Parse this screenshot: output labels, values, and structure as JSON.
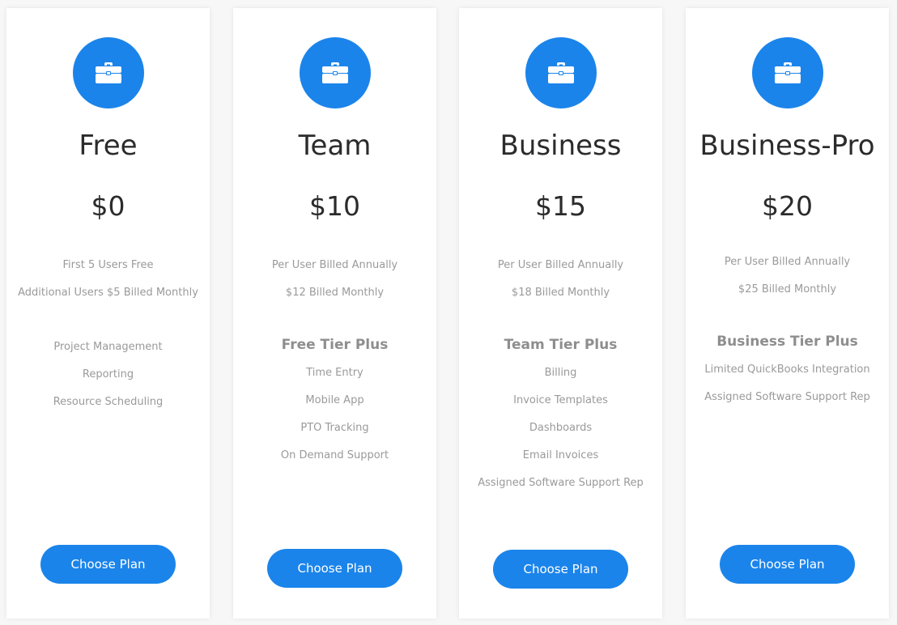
{
  "accent_color": "#1b84ea",
  "plans": [
    {
      "icon": "briefcase-icon",
      "name": "Free",
      "price": "$0",
      "billing": [
        "First 5 Users Free",
        "Additional Users $5 Billed Monthly"
      ],
      "tier_heading": "",
      "features": [
        "Project Management",
        "Reporting",
        "Resource Scheduling"
      ],
      "button_label": "Choose Plan"
    },
    {
      "icon": "briefcase-icon",
      "name": "Team",
      "price": "$10",
      "billing": [
        "Per User Billed Annually",
        "$12 Billed Monthly"
      ],
      "tier_heading": "Free Tier Plus",
      "features": [
        "Time Entry",
        "Mobile App",
        "PTO Tracking",
        "On Demand Support"
      ],
      "button_label": "Choose Plan"
    },
    {
      "icon": "briefcase-icon",
      "name": "Business",
      "price": "$15",
      "billing": [
        "Per User Billed Annually",
        "$18 Billed Monthly"
      ],
      "tier_heading": "Team Tier Plus",
      "features": [
        "Billing",
        "Invoice Templates",
        "Dashboards",
        "Email Invoices",
        "Assigned Software Support Rep"
      ],
      "button_label": "Choose Plan"
    },
    {
      "icon": "briefcase-icon",
      "name": "Business-Pro",
      "price": "$20",
      "billing": [
        "Per User Billed Annually",
        "$25 Billed Monthly"
      ],
      "tier_heading": "Business Tier Plus",
      "features": [
        "Limited QuickBooks Integration",
        "Assigned Software Support Rep"
      ],
      "button_label": "Choose Plan"
    }
  ]
}
